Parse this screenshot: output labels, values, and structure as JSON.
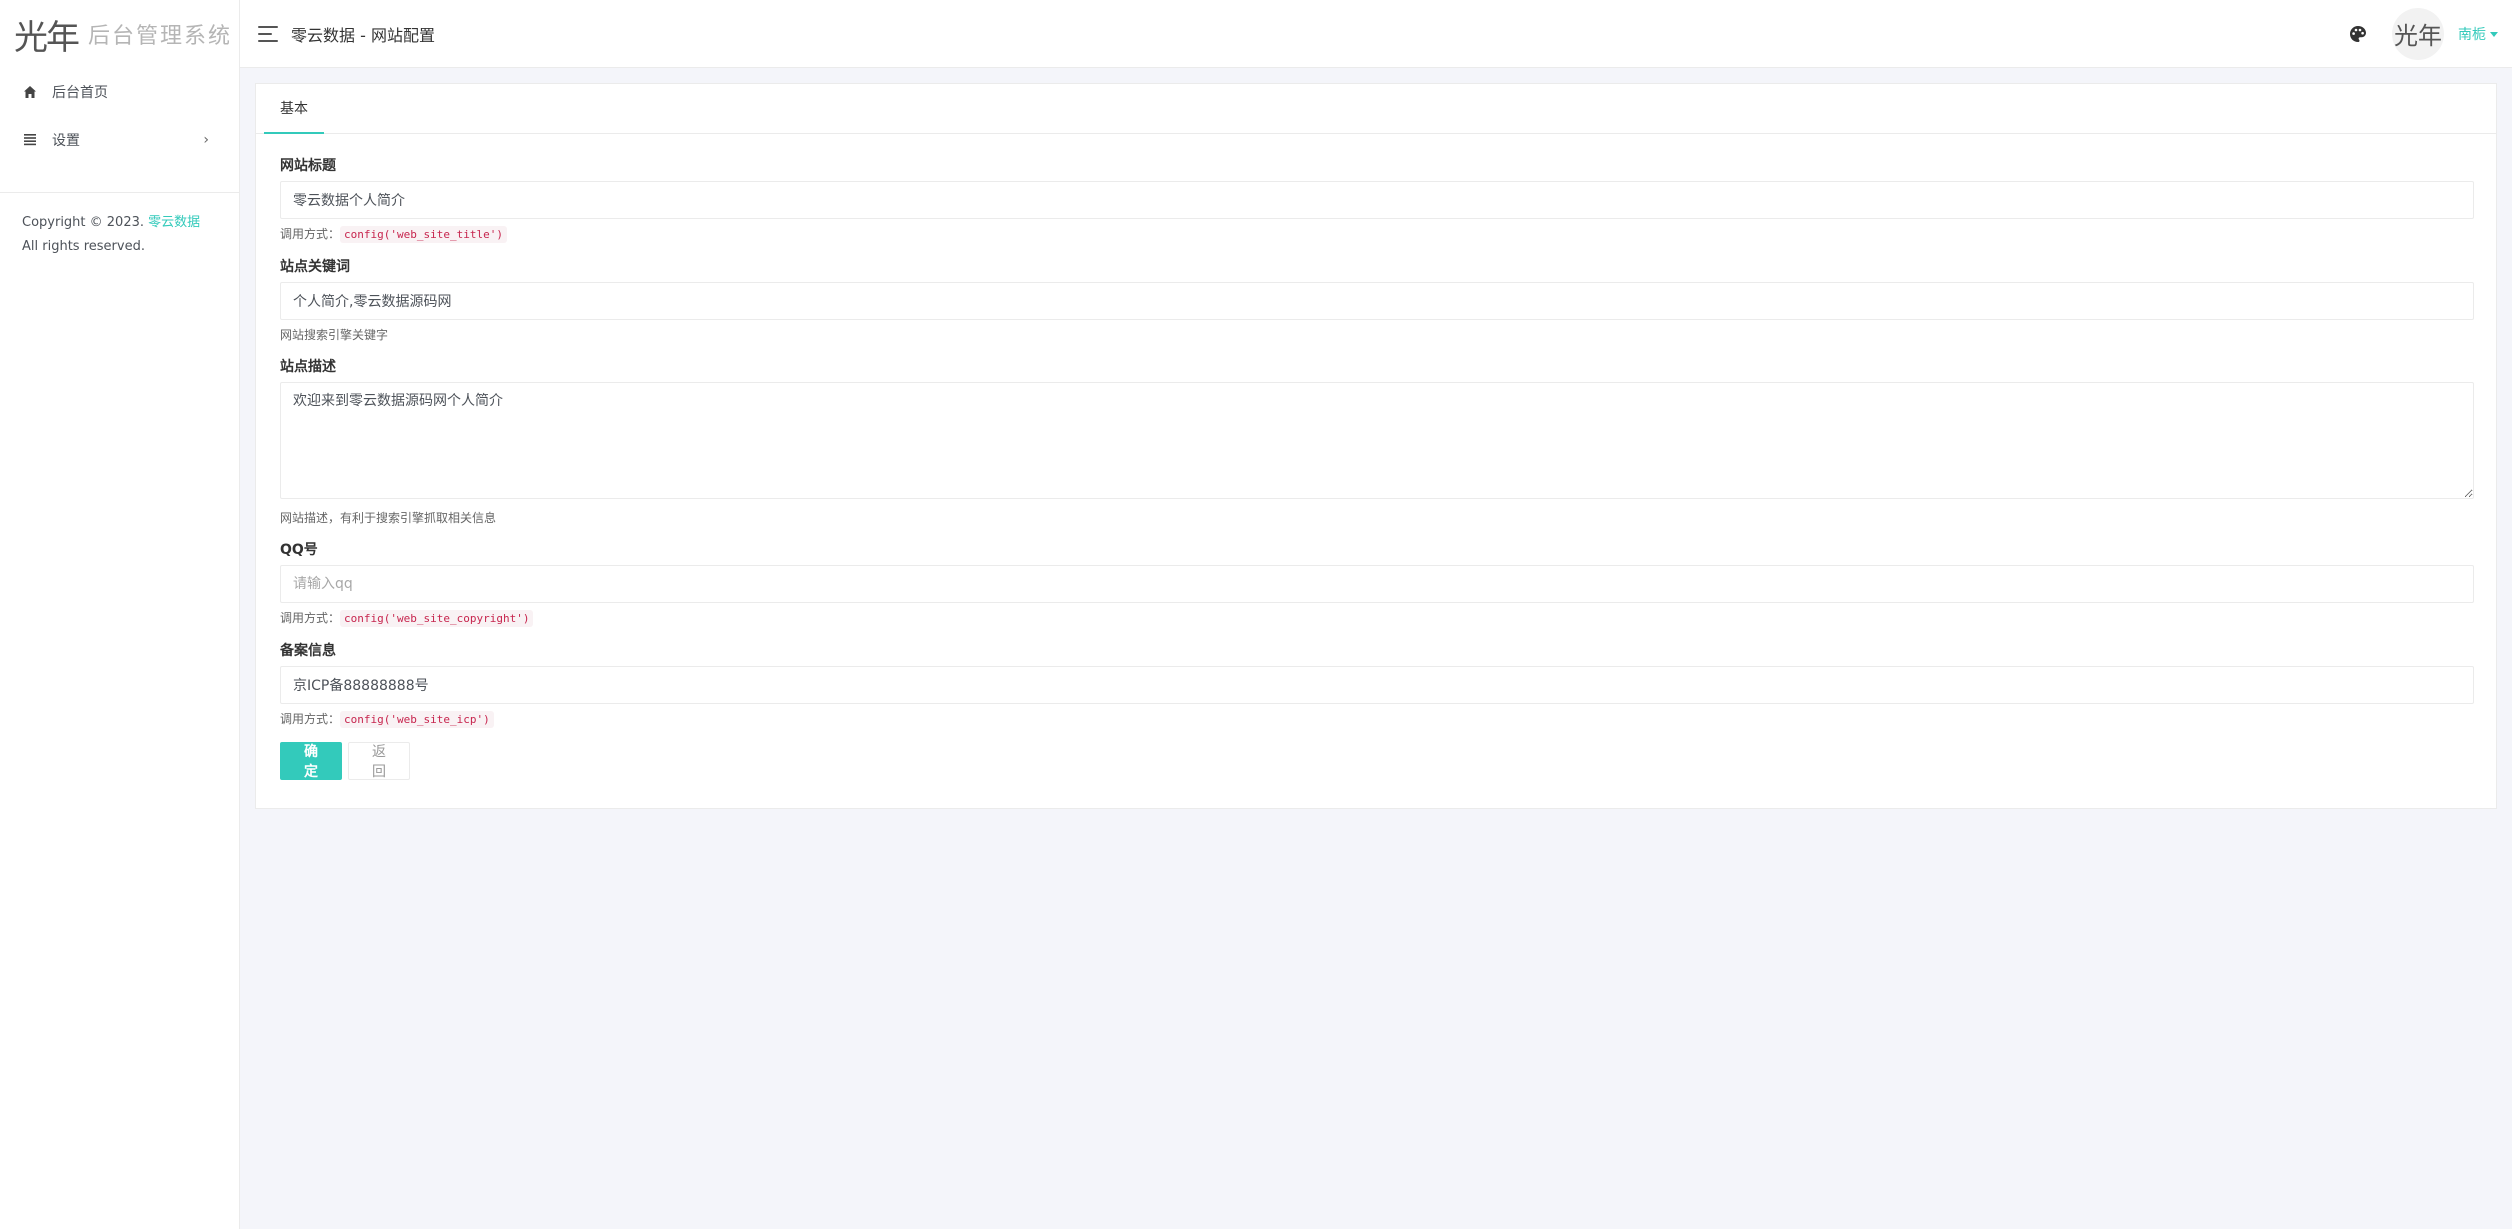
{
  "brand": {
    "mark": "光年",
    "system_name": "后台管理系统"
  },
  "sidebar": {
    "items": [
      {
        "label": "后台首页",
        "icon": "home-icon"
      },
      {
        "label": "设置",
        "icon": "list-icon",
        "arrow": "›"
      }
    ],
    "copyright_prefix": "Copyright © 2023. ",
    "copyright_link": "零云数据",
    "copyright_suffix": " All rights reserved."
  },
  "header": {
    "title": "零云数据 - 网站配置",
    "avatar_text": "光年",
    "username": "南栀"
  },
  "tabs": [
    {
      "label": "基本"
    }
  ],
  "form": {
    "site_title": {
      "label": "网站标题",
      "value": "零云数据个人简介",
      "help_prefix": "调用方式：",
      "help_code": "config('web_site_title')"
    },
    "keywords": {
      "label": "站点关键词",
      "value": "个人简介,零云数据源码网",
      "help": "网站搜索引擎关键字"
    },
    "description": {
      "label": "站点描述",
      "value": "欢迎来到零云数据源码网个人简介",
      "help": "网站描述，有利于搜索引擎抓取相关信息"
    },
    "qq": {
      "label": "QQ号",
      "value": "",
      "placeholder": "请输入qq",
      "help_prefix": "调用方式：",
      "help_code": "config('web_site_copyright')"
    },
    "icp": {
      "label": "备案信息",
      "value": "京ICP备88888888号",
      "help_prefix": "调用方式：",
      "help_code": "config('web_site_icp')"
    }
  },
  "buttons": {
    "submit": "确 定",
    "back": "返 回"
  },
  "colors": {
    "accent": "#33cabb",
    "background": "#f4f5fa",
    "code": "#c7254e"
  }
}
